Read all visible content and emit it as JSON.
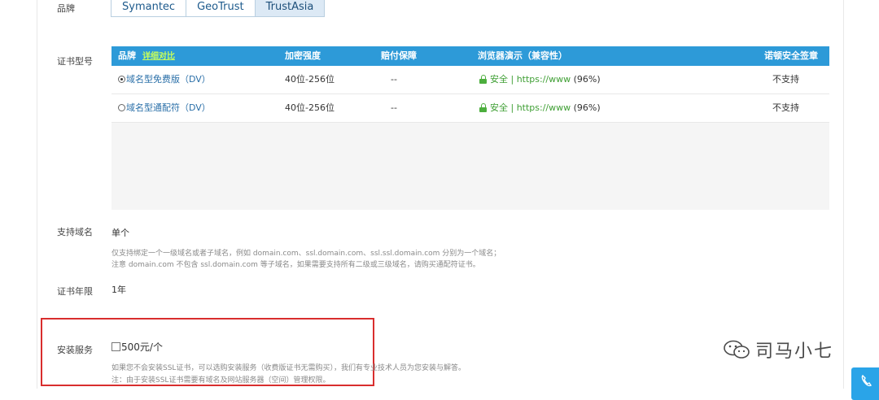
{
  "labels": {
    "brand": "品牌",
    "cert_model": "证书型号",
    "domains": "支持域名",
    "years": "证书年限",
    "install": "安装服务"
  },
  "brand_tabs": [
    {
      "label": "Symantec",
      "active": false
    },
    {
      "label": "GeoTrust",
      "active": false
    },
    {
      "label": "TrustAsia",
      "active": true
    }
  ],
  "table": {
    "headers": {
      "brand": "品牌",
      "detail_link": "详细对比",
      "encryption": "加密强度",
      "compensation": "赔付保障",
      "browser": "浏览器演示（兼容性）",
      "seal": "诺顿安全签章"
    },
    "rows": [
      {
        "selected": true,
        "name": "域名型免费版（DV）",
        "encryption": "40位-256位",
        "compensation": "--",
        "secure_text": "安全 | https://www",
        "compat": "(96%)",
        "seal": "不支持"
      },
      {
        "selected": false,
        "name": "域名型通配符（DV）",
        "encryption": "40位-256位",
        "compensation": "--",
        "secure_text": "安全 | https://www",
        "compat": "(96%)",
        "seal": "不支持"
      }
    ]
  },
  "domains": {
    "value": "单个",
    "note1": "仅支持绑定一个一级域名或者子域名，例如 domain.com、ssl.domain.com、ssl.ssl.domain.com 分别为一个域名；",
    "note2": "注意 domain.com 不包含 ssl.domain.com 等子域名，如果需要支持所有二级或三级域名，请购买通配符证书。"
  },
  "years": {
    "value": "1年"
  },
  "install": {
    "option": "500元/个",
    "note1": "如果您不会安装SSL证书，可以选购安装服务（收费版证书无需购买），我们有专业技术人员为您安装与解答。",
    "note2": "注：由于安装SSL证书需要有域名及网站服务器（空间）管理权限。"
  },
  "watermark": {
    "text": "司马小七"
  },
  "colors": {
    "header_blue": "#2d9ad8",
    "highlight_red": "#d92e2e",
    "secure_green": "#3f9f34",
    "link_green": "#c9ff5a"
  }
}
